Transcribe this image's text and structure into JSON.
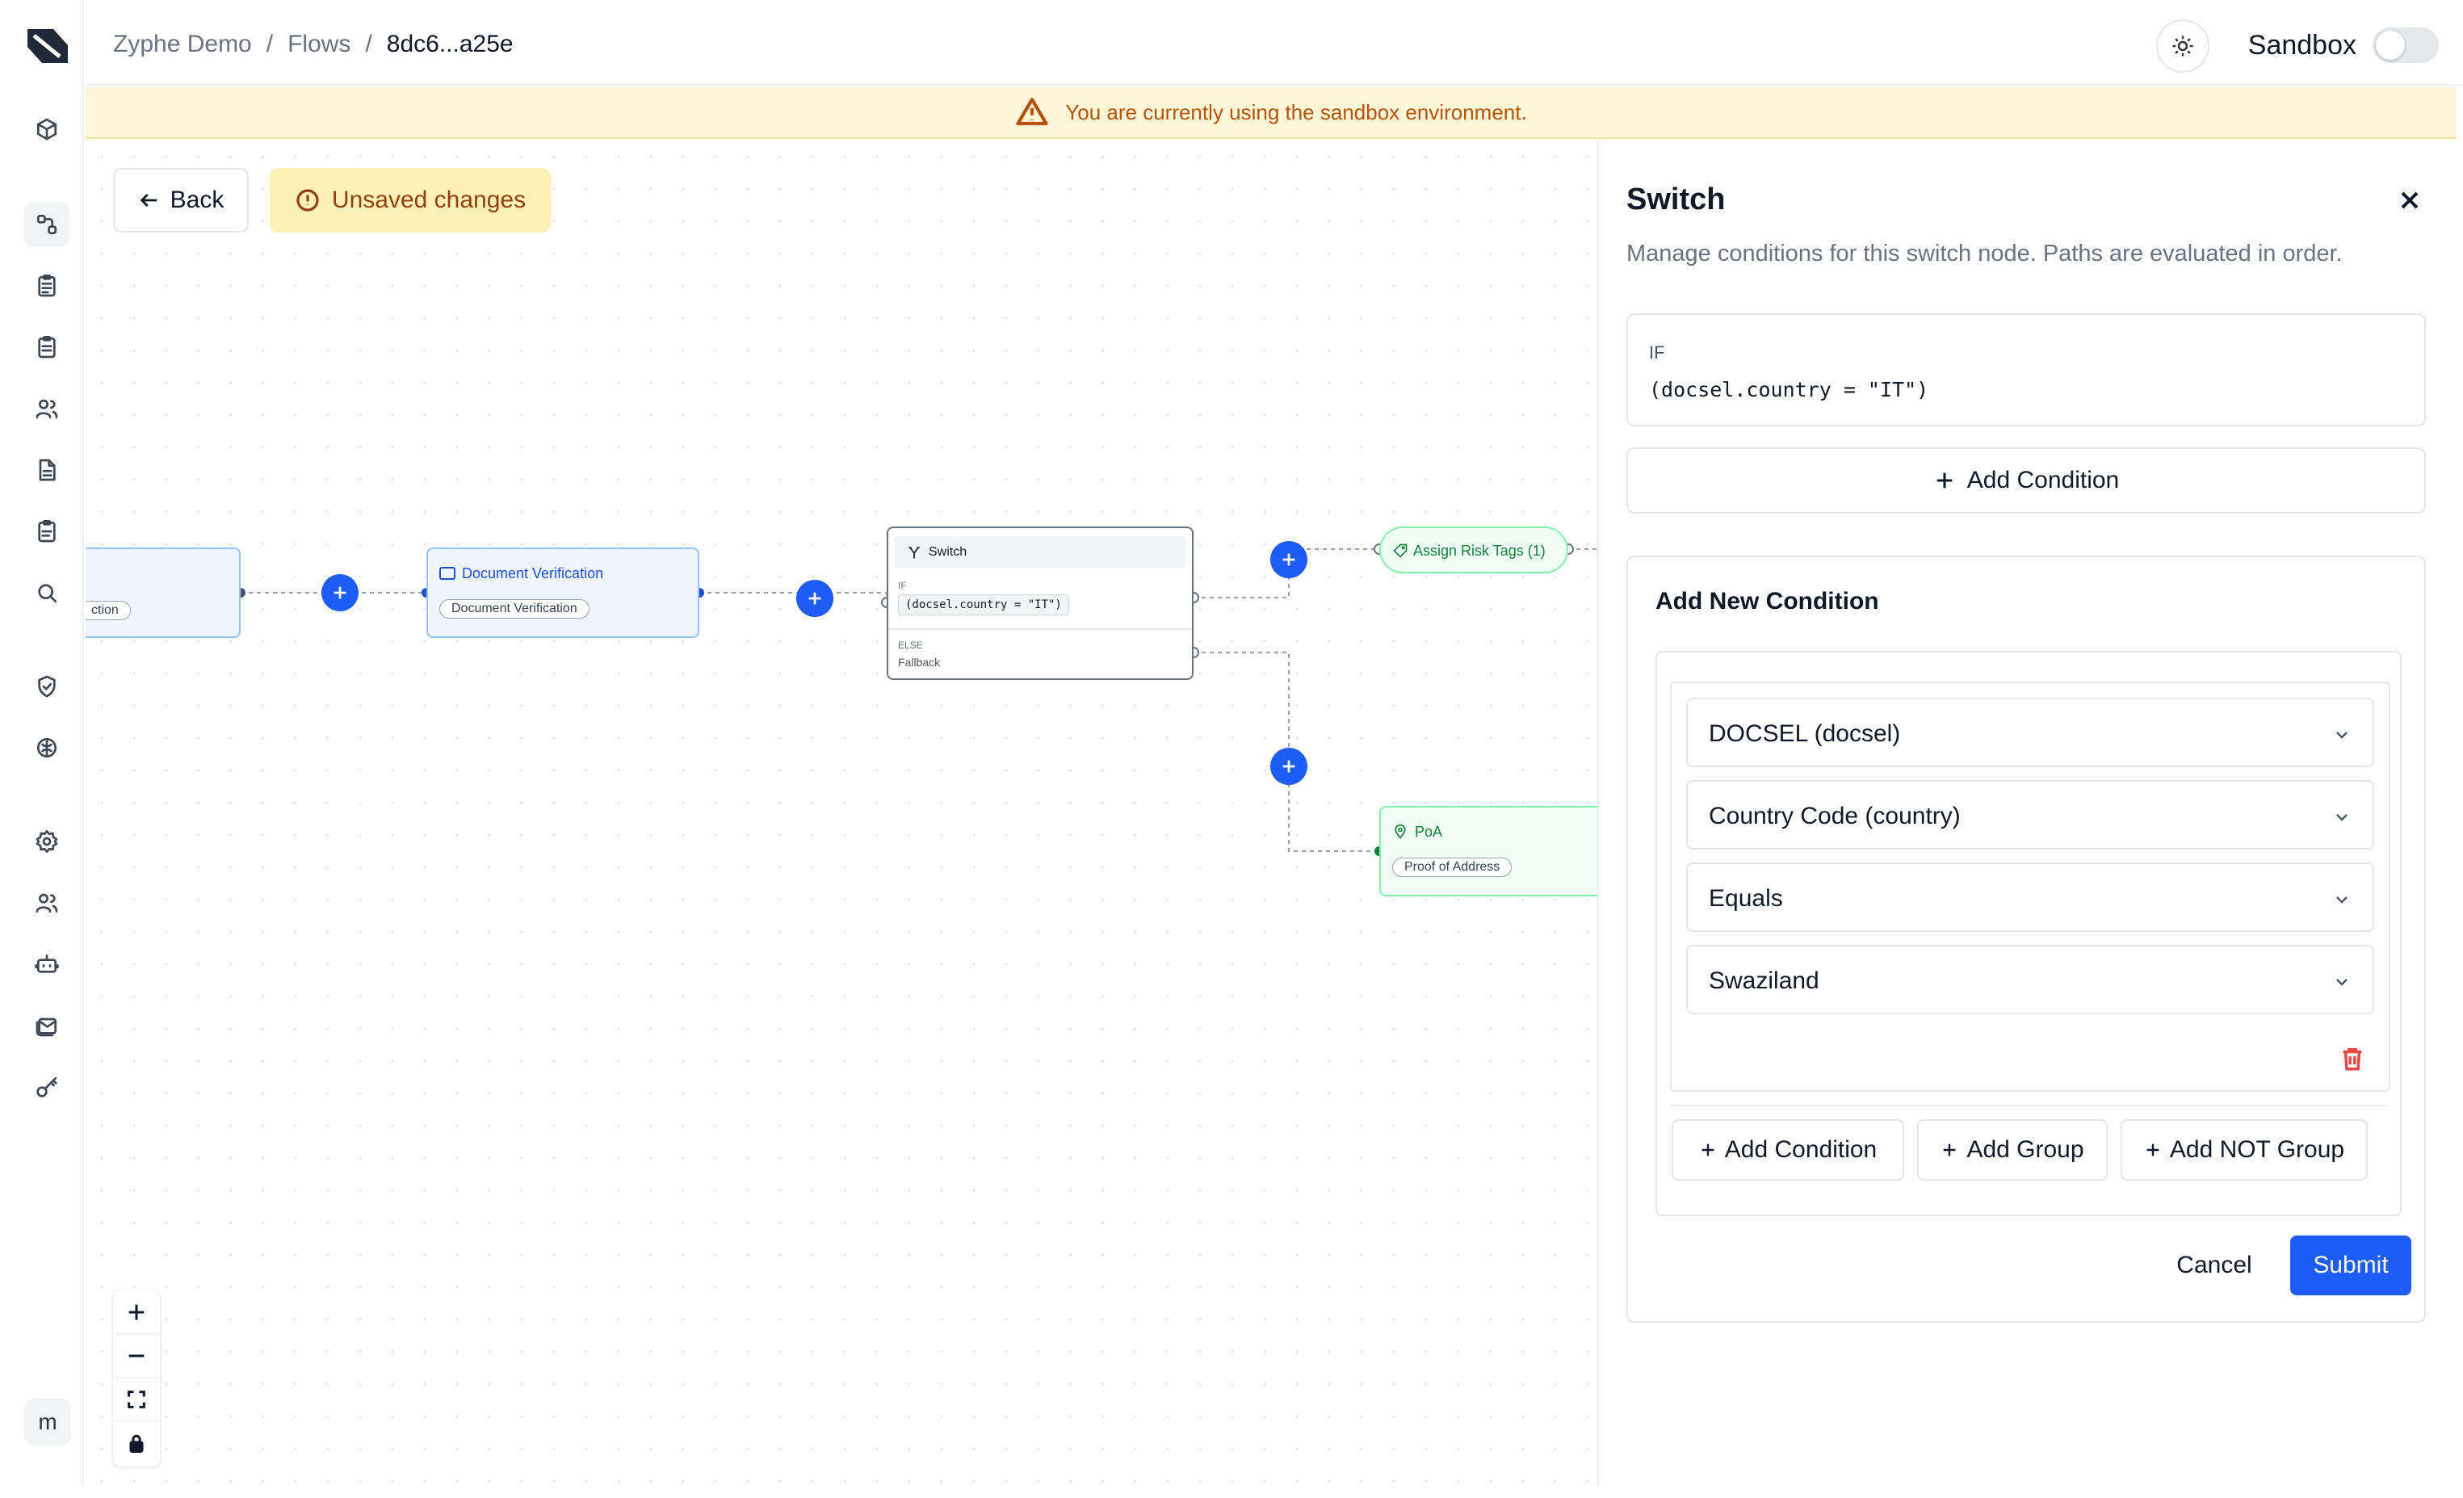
{
  "header": {
    "breadcrumb": [
      "Zyphe Demo",
      "Flows",
      "8dc6...a25e"
    ],
    "separator": "/",
    "sandbox_label": "Sandbox"
  },
  "sidebar": {
    "avatar_initial": "m",
    "items": [
      "box-icon",
      "flows-icon",
      "clipboard-icon",
      "clipboard-list-icon",
      "users-icon",
      "file-text-icon",
      "clipboard-check-icon",
      "search-icon",
      "shield-icon",
      "brain-icon",
      "settings-icon",
      "team-icon",
      "bot-icon",
      "mail-stack-icon",
      "key-icon"
    ],
    "active_index": 1
  },
  "banner": {
    "text": "You are currently using the sandbox environment."
  },
  "canvas": {
    "back_label": "Back",
    "unsaved_label": "Unsaved changes",
    "nodes": {
      "prev_pill": "ction",
      "docver_title": "Document Verification",
      "docver_pill": "Document Verification",
      "switch_title": "Switch",
      "switch_if": "IF",
      "switch_condition": "(docsel.country = \"IT\")",
      "switch_else": "ELSE",
      "switch_fallback": "Fallback",
      "risk_title": "Assign Risk Tags (1)",
      "poa_title": "PoA",
      "poa_pill": "Proof of Address"
    }
  },
  "panel": {
    "title": "Switch",
    "description": "Manage conditions for this switch node. Paths are evaluated in order.",
    "if_label": "IF",
    "if_expression": "(docsel.country = \"IT\")",
    "add_condition_label": "Add Condition",
    "new_condition": {
      "title": "Add New Condition",
      "selects": [
        "DOCSEL (docsel)",
        "Country Code (country)",
        "Equals",
        "Swaziland"
      ],
      "add_condition": "Add Condition",
      "add_group": "Add Group",
      "add_not_group": "Add NOT Group"
    },
    "cancel_label": "Cancel",
    "submit_label": "Submit"
  },
  "colors": {
    "accent": "#1d5cf5",
    "banner_bg": "#fdf7d8",
    "banner_text": "#b45309",
    "unsaved_bg": "#fdf1b8",
    "danger": "#ef4444"
  }
}
